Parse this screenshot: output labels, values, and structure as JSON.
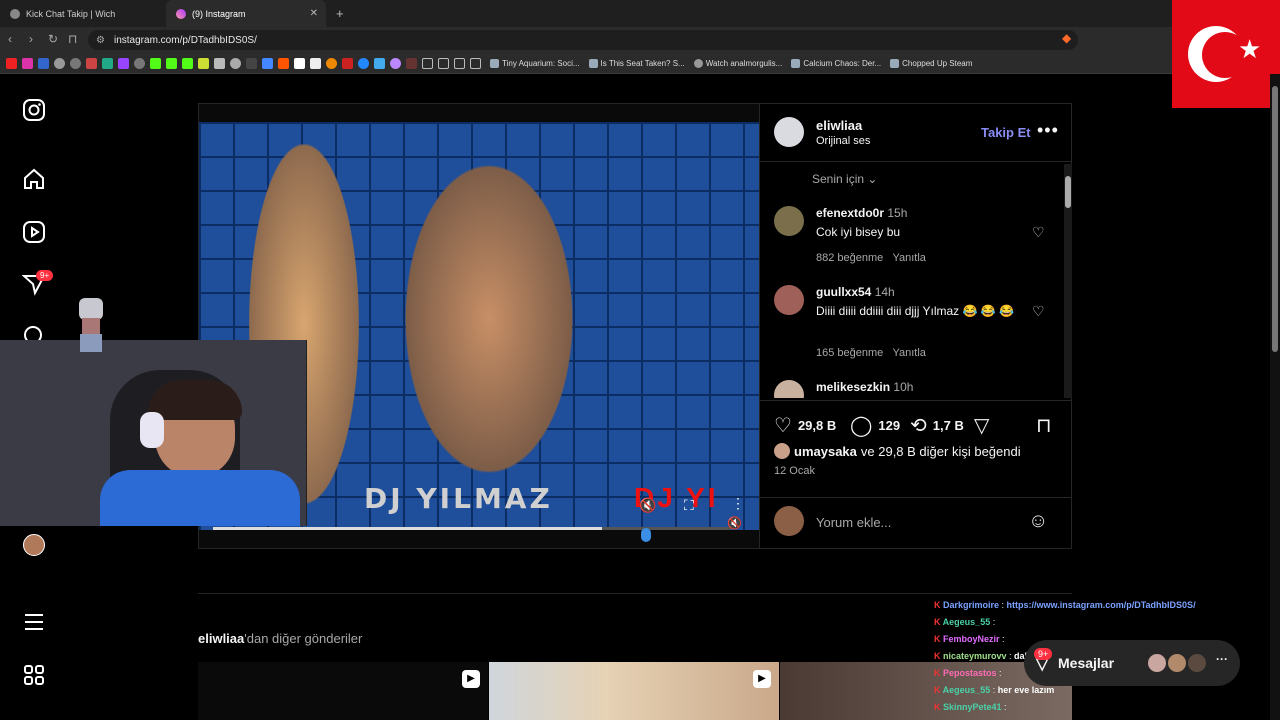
{
  "browser": {
    "tabs": [
      {
        "title": "Kick Chat Takip | Wich",
        "active": false
      },
      {
        "title": "(9) Instagram",
        "active": true
      }
    ],
    "url": "instagram.com/p/DTadhbIDS0S/",
    "bookmarks": [
      {
        "label": "Tiny Aquarium: Soci..."
      },
      {
        "label": "Is This Seat Taken? S..."
      },
      {
        "label": "Watch analmorgulis..."
      },
      {
        "label": "Calcium Chaos: Der..."
      },
      {
        "label": "Chopped Up Steam"
      }
    ]
  },
  "sidebar": {
    "notifications_badge": "9+"
  },
  "video": {
    "overlay_text": "DJ YILMAZ",
    "overlay_text_red": "DJ YI",
    "progress": 0.75
  },
  "post": {
    "author": "eliwliaa",
    "audio": "Orijinal ses",
    "follow_label": "Takip Et",
    "sort_label": "Senin için",
    "comments": [
      {
        "user": "efenextdo0r",
        "time": "15h",
        "text": "Cok iyi bisey bu",
        "likes": "882 beğenme",
        "reply": "Yanıtla"
      },
      {
        "user": "guullxx54",
        "time": "14h",
        "text": "Diiii diiii ddiiii diii djjj Yılmaz 😂 😂 😂",
        "likes": "165 beğenme",
        "reply": "Yanıtla"
      },
      {
        "user": "melikesezkin",
        "time": "10h",
        "text": "",
        "likes": "",
        "reply": ""
      }
    ],
    "like_count": "29,8 B",
    "comment_count": "129",
    "repost_count": "1,7 B",
    "liked_by_user": "umaysaka",
    "liked_by_rest": "ve 29,8 B diğer kişi beğendi",
    "date": "12 Ocak",
    "comment_placeholder": "Yorum ekle..."
  },
  "more_posts": {
    "author": "eliwliaa",
    "suffix": "'dan diğer gönderiler"
  },
  "chat": [
    {
      "user": "Darkgrimoire",
      "message": "https://www.instagram.com/p/DTadhbIDS0S/",
      "color": "#7aa2ff"
    },
    {
      "user": "Aegeus_55",
      "message": "",
      "color": "#4ad1a8"
    },
    {
      "user": "FemboyNezir",
      "message": "",
      "color": "#e36cff"
    },
    {
      "user": "nicateymurovv",
      "message": "dalgakliç",
      "color": "#9ee08a"
    },
    {
      "user": "Pepostastos",
      "message": "",
      "color": "#ff6bb5"
    },
    {
      "user": "Aegeus_55",
      "message": "her eve lazım",
      "color": "#4ad1a8"
    },
    {
      "user": "SkinnyPete41",
      "message": "",
      "color": "#4ad1a8"
    }
  ],
  "messages": {
    "label": "Mesajlar",
    "badge": "9+"
  }
}
